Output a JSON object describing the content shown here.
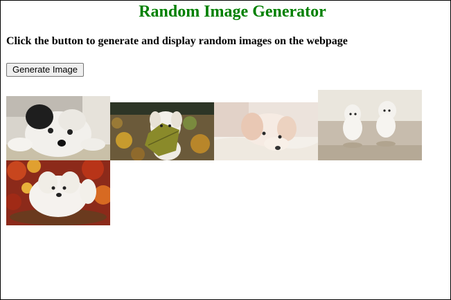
{
  "page": {
    "title": "Random Image Generator",
    "description": "Click the button to generate and display random images on the webpage",
    "button_label": "Generate Image"
  },
  "colors": {
    "title": "#008000",
    "background": "#ffffff",
    "button_bg": "#efefef",
    "button_border": "#767676"
  },
  "images": [
    {
      "subject": "white puppy with black ear lying down"
    },
    {
      "subject": "white puppy holding leaf in autumn leaves"
    },
    {
      "subject": "cream puppy resting on blanket"
    },
    {
      "subject": "two white puppies running on floor"
    },
    {
      "subject": "white puppy in red autumn leaves basket"
    }
  ]
}
